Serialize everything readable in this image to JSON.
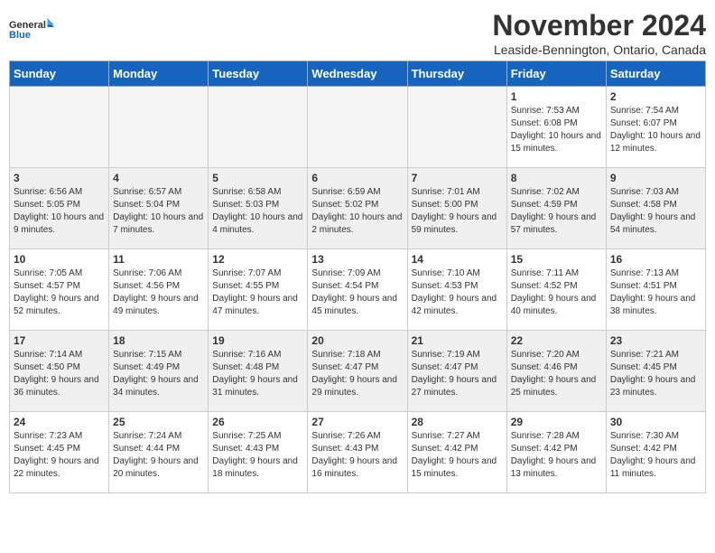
{
  "logo": {
    "line1": "General",
    "line2": "Blue"
  },
  "title": "November 2024",
  "location": "Leaside-Bennington, Ontario, Canada",
  "weekdays": [
    "Sunday",
    "Monday",
    "Tuesday",
    "Wednesday",
    "Thursday",
    "Friday",
    "Saturday"
  ],
  "weeks": [
    [
      {
        "day": "",
        "info": ""
      },
      {
        "day": "",
        "info": ""
      },
      {
        "day": "",
        "info": ""
      },
      {
        "day": "",
        "info": ""
      },
      {
        "day": "",
        "info": ""
      },
      {
        "day": "1",
        "info": "Sunrise: 7:53 AM\nSunset: 6:08 PM\nDaylight: 10 hours and 15 minutes."
      },
      {
        "day": "2",
        "info": "Sunrise: 7:54 AM\nSunset: 6:07 PM\nDaylight: 10 hours and 12 minutes."
      }
    ],
    [
      {
        "day": "3",
        "info": "Sunrise: 6:56 AM\nSunset: 5:05 PM\nDaylight: 10 hours and 9 minutes."
      },
      {
        "day": "4",
        "info": "Sunrise: 6:57 AM\nSunset: 5:04 PM\nDaylight: 10 hours and 7 minutes."
      },
      {
        "day": "5",
        "info": "Sunrise: 6:58 AM\nSunset: 5:03 PM\nDaylight: 10 hours and 4 minutes."
      },
      {
        "day": "6",
        "info": "Sunrise: 6:59 AM\nSunset: 5:02 PM\nDaylight: 10 hours and 2 minutes."
      },
      {
        "day": "7",
        "info": "Sunrise: 7:01 AM\nSunset: 5:00 PM\nDaylight: 9 hours and 59 minutes."
      },
      {
        "day": "8",
        "info": "Sunrise: 7:02 AM\nSunset: 4:59 PM\nDaylight: 9 hours and 57 minutes."
      },
      {
        "day": "9",
        "info": "Sunrise: 7:03 AM\nSunset: 4:58 PM\nDaylight: 9 hours and 54 minutes."
      }
    ],
    [
      {
        "day": "10",
        "info": "Sunrise: 7:05 AM\nSunset: 4:57 PM\nDaylight: 9 hours and 52 minutes."
      },
      {
        "day": "11",
        "info": "Sunrise: 7:06 AM\nSunset: 4:56 PM\nDaylight: 9 hours and 49 minutes."
      },
      {
        "day": "12",
        "info": "Sunrise: 7:07 AM\nSunset: 4:55 PM\nDaylight: 9 hours and 47 minutes."
      },
      {
        "day": "13",
        "info": "Sunrise: 7:09 AM\nSunset: 4:54 PM\nDaylight: 9 hours and 45 minutes."
      },
      {
        "day": "14",
        "info": "Sunrise: 7:10 AM\nSunset: 4:53 PM\nDaylight: 9 hours and 42 minutes."
      },
      {
        "day": "15",
        "info": "Sunrise: 7:11 AM\nSunset: 4:52 PM\nDaylight: 9 hours and 40 minutes."
      },
      {
        "day": "16",
        "info": "Sunrise: 7:13 AM\nSunset: 4:51 PM\nDaylight: 9 hours and 38 minutes."
      }
    ],
    [
      {
        "day": "17",
        "info": "Sunrise: 7:14 AM\nSunset: 4:50 PM\nDaylight: 9 hours and 36 minutes."
      },
      {
        "day": "18",
        "info": "Sunrise: 7:15 AM\nSunset: 4:49 PM\nDaylight: 9 hours and 34 minutes."
      },
      {
        "day": "19",
        "info": "Sunrise: 7:16 AM\nSunset: 4:48 PM\nDaylight: 9 hours and 31 minutes."
      },
      {
        "day": "20",
        "info": "Sunrise: 7:18 AM\nSunset: 4:47 PM\nDaylight: 9 hours and 29 minutes."
      },
      {
        "day": "21",
        "info": "Sunrise: 7:19 AM\nSunset: 4:47 PM\nDaylight: 9 hours and 27 minutes."
      },
      {
        "day": "22",
        "info": "Sunrise: 7:20 AM\nSunset: 4:46 PM\nDaylight: 9 hours and 25 minutes."
      },
      {
        "day": "23",
        "info": "Sunrise: 7:21 AM\nSunset: 4:45 PM\nDaylight: 9 hours and 23 minutes."
      }
    ],
    [
      {
        "day": "24",
        "info": "Sunrise: 7:23 AM\nSunset: 4:45 PM\nDaylight: 9 hours and 22 minutes."
      },
      {
        "day": "25",
        "info": "Sunrise: 7:24 AM\nSunset: 4:44 PM\nDaylight: 9 hours and 20 minutes."
      },
      {
        "day": "26",
        "info": "Sunrise: 7:25 AM\nSunset: 4:43 PM\nDaylight: 9 hours and 18 minutes."
      },
      {
        "day": "27",
        "info": "Sunrise: 7:26 AM\nSunset: 4:43 PM\nDaylight: 9 hours and 16 minutes."
      },
      {
        "day": "28",
        "info": "Sunrise: 7:27 AM\nSunset: 4:42 PM\nDaylight: 9 hours and 15 minutes."
      },
      {
        "day": "29",
        "info": "Sunrise: 7:28 AM\nSunset: 4:42 PM\nDaylight: 9 hours and 13 minutes."
      },
      {
        "day": "30",
        "info": "Sunrise: 7:30 AM\nSunset: 4:42 PM\nDaylight: 9 hours and 11 minutes."
      }
    ]
  ]
}
